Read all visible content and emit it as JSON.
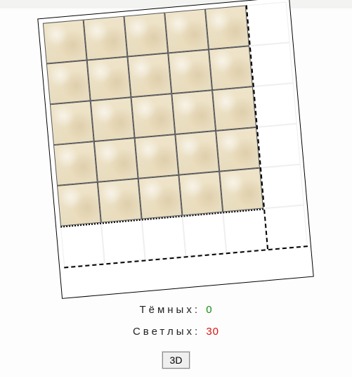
{
  "board": {
    "rows": 5,
    "cols": 5,
    "rotation_deg": -5
  },
  "counters": {
    "dark_label": "Тёмных:",
    "dark_value": "0",
    "light_label": "Светлых:",
    "light_value": "30"
  },
  "buttons": {
    "three_d": "3D"
  },
  "colors": {
    "dark_count": "#138f13",
    "light_count": "#d11"
  }
}
